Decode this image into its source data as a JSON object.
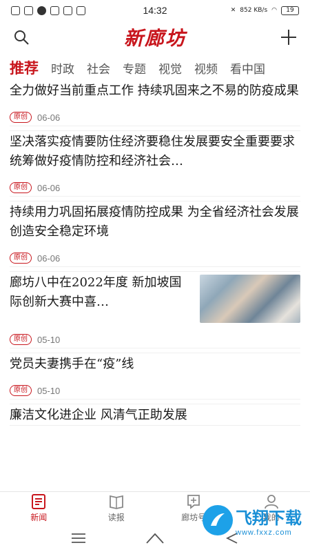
{
  "status_bar": {
    "time": "14:32",
    "network_speed": "852 KB/s",
    "battery": "19"
  },
  "header": {
    "logo": "新廊坊",
    "search_icon": "search-icon",
    "add_icon": "plus-icon"
  },
  "tabs": [
    {
      "label": "推荐",
      "active": true
    },
    {
      "label": "时政"
    },
    {
      "label": "社会"
    },
    {
      "label": "专题"
    },
    {
      "label": "视觉"
    },
    {
      "label": "视频"
    },
    {
      "label": "看中国"
    }
  ],
  "articles": [
    {
      "title": "全力做好当前重点工作  持续巩固来之不易的防疫成果",
      "badge": "原创",
      "date": "06-06"
    },
    {
      "title": "坚决落实疫情要防住经济要稳住发展要安全重要要求  统筹做好疫情防控和经济社会…",
      "badge": "原创",
      "date": "06-06"
    },
    {
      "title": "持续用力巩固拓展疫情防控成果  为全省经济社会发展创造安全稳定环境",
      "badge": "原创",
      "date": "06-06"
    },
    {
      "title": "廊坊八中在2022年度  新加坡国际创新大赛中喜…",
      "badge": "原创",
      "date": "05-10",
      "has_image": true
    },
    {
      "title": "党员夫妻携手在“疫”线",
      "badge": "原创",
      "date": "05-10"
    },
    {
      "title": "廉洁文化进企业  风清气正助发展"
    }
  ],
  "bottom_nav": [
    {
      "label": "新闻",
      "icon": "news-icon",
      "active": true
    },
    {
      "label": "读报",
      "icon": "newspaper-icon"
    },
    {
      "label": "廊坊号",
      "icon": "add-post-icon"
    },
    {
      "label": "我的",
      "icon": "profile-icon"
    }
  ],
  "watermark": {
    "main": "飞翔下载",
    "sub": "www.fxxz.com"
  },
  "colors": {
    "brand_red": "#c8161d",
    "watermark_blue": "#1a8fd6"
  }
}
